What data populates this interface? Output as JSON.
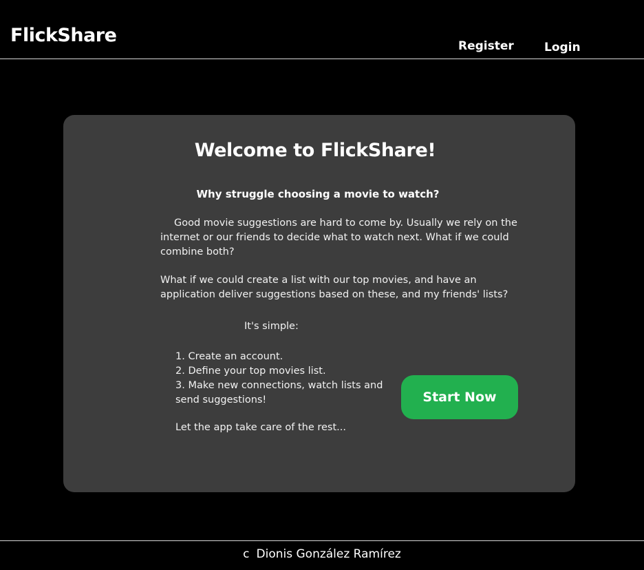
{
  "header": {
    "brand": "FlickShare",
    "nav": {
      "register": "Register",
      "login": "Login"
    }
  },
  "card": {
    "title": "Welcome to FlickShare!",
    "question": "Why struggle choosing a movie to watch?",
    "paragraph1": "Good movie suggestions are hard to come by. Usually we rely on the internet or our friends to decide what to watch next. What if we could combine both?",
    "paragraph2": "What if we could create a list with our top movies, and have an application deliver suggestions based on these, and my friends' lists?",
    "simple": "It's simple:",
    "steps": [
      "1. Create an account.",
      "2. Define your top movies list.",
      "3. Make new connections, watch lists and send suggestions!"
    ],
    "closing": "Let the app take care of the rest...",
    "cta": "Start Now"
  },
  "footer": {
    "copyright_mark": "c",
    "author": "Dionis González Ramírez"
  },
  "colors": {
    "background": "#000000",
    "card": "#3d3d3d",
    "accent": "#22b04f"
  }
}
